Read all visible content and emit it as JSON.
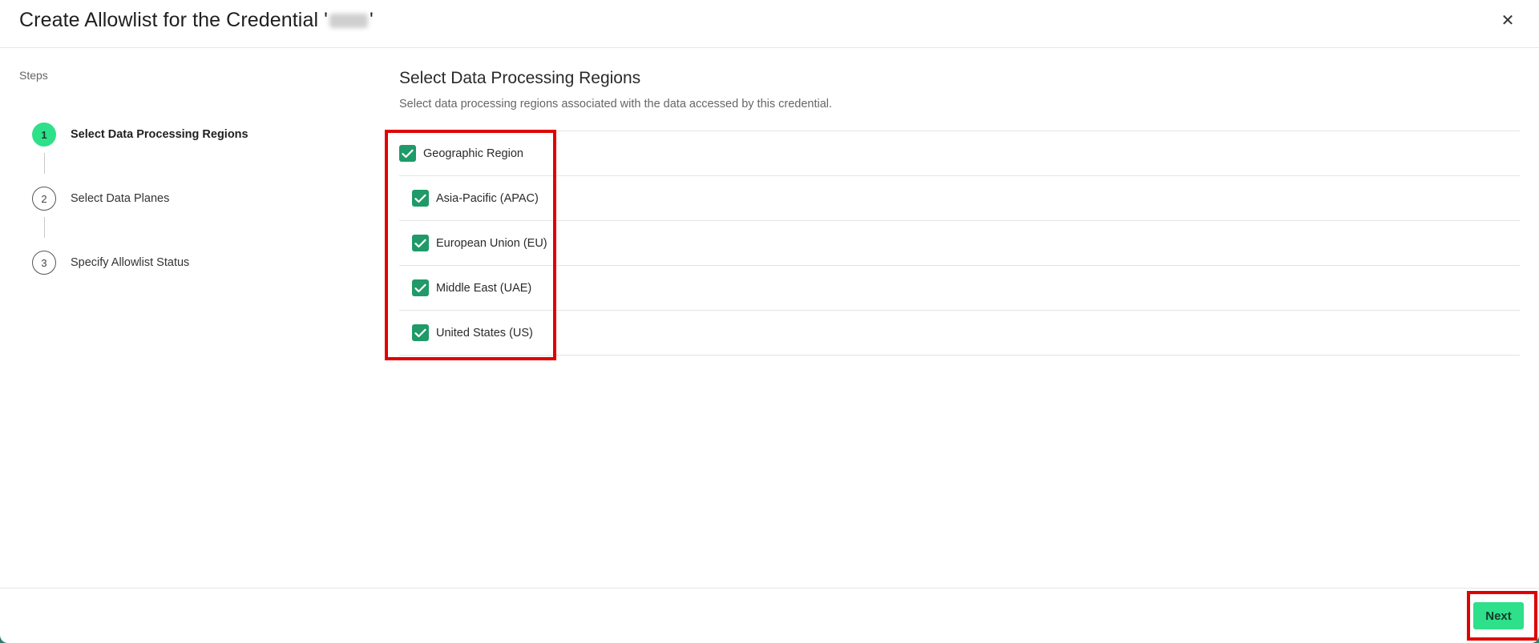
{
  "dialog": {
    "title": "Create Allowlist for the Credential '",
    "title_suffix": "'",
    "close_icon": "close-icon",
    "close_glyph": "✕"
  },
  "steps": {
    "label": "Steps",
    "items": [
      {
        "number": "1",
        "label": "Select Data Processing Regions",
        "state": "active"
      },
      {
        "number": "2",
        "label": "Select Data Planes",
        "state": "pending"
      },
      {
        "number": "3",
        "label": "Specify Allowlist Status",
        "state": "pending"
      }
    ]
  },
  "main": {
    "title": "Select Data Processing Regions",
    "description": "Select data processing regions associated with the data accessed by this credential.",
    "regions": [
      {
        "label": "Geographic Region",
        "checked": true,
        "level": 0
      },
      {
        "label": "Asia-Pacific (APAC)",
        "checked": true,
        "level": 1
      },
      {
        "label": "European Union (EU)",
        "checked": true,
        "level": 1
      },
      {
        "label": "Middle East (UAE)",
        "checked": true,
        "level": 1
      },
      {
        "label": "United States (US)",
        "checked": true,
        "level": 1
      }
    ]
  },
  "footer": {
    "next_label": "Next"
  },
  "colors": {
    "accent": "#2ee08a",
    "checkbox": "#1f9a68",
    "highlight": "#e00000"
  }
}
